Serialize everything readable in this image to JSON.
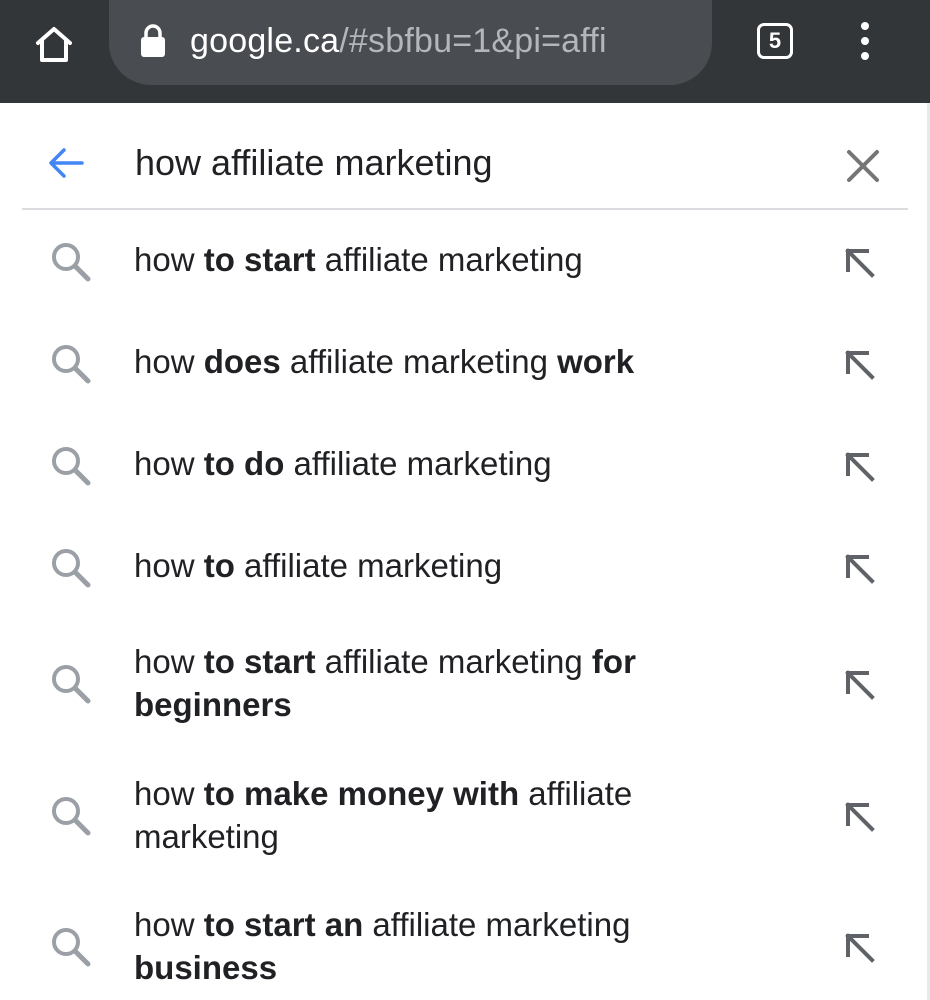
{
  "browser": {
    "url_host": "google.ca",
    "url_path": "/#sbfbu=1&pi=affi",
    "tab_count": "5",
    "icons": {
      "home": "home-icon",
      "lock": "lock-icon",
      "tabs": "tab-switcher-icon",
      "menu": "more-vert-icon"
    },
    "colors": {
      "toolbar": "#323639",
      "omnibox": "#494c50",
      "url_path": "#b4b7ba"
    }
  },
  "search": {
    "query": "how affiliate marketing",
    "icons": {
      "back": "arrow-back-icon",
      "clear": "close-icon"
    },
    "colors": {
      "back_arrow": "#4285f4",
      "icon_gray": "#757575"
    }
  },
  "suggestions": [
    {
      "parts": [
        {
          "t": "how ",
          "b": false
        },
        {
          "t": "to start",
          "b": true
        },
        {
          "t": " affiliate marketing",
          "b": false
        }
      ]
    },
    {
      "parts": [
        {
          "t": "how ",
          "b": false
        },
        {
          "t": "does",
          "b": true
        },
        {
          "t": " affiliate marketing ",
          "b": false
        },
        {
          "t": "work",
          "b": true
        }
      ]
    },
    {
      "parts": [
        {
          "t": "how ",
          "b": false
        },
        {
          "t": "to do",
          "b": true
        },
        {
          "t": " affiliate marketing",
          "b": false
        }
      ]
    },
    {
      "parts": [
        {
          "t": "how ",
          "b": false
        },
        {
          "t": "to",
          "b": true
        },
        {
          "t": " affiliate marketing",
          "b": false
        }
      ]
    },
    {
      "parts": [
        {
          "t": "how ",
          "b": false
        },
        {
          "t": "to start",
          "b": true
        },
        {
          "t": " affiliate marketing ",
          "b": false
        },
        {
          "t": "for",
          "b": true
        },
        {
          "t": " ",
          "b": false
        },
        {
          "t": "beginners",
          "b": true
        }
      ]
    },
    {
      "parts": [
        {
          "t": "how ",
          "b": false
        },
        {
          "t": "to make money with",
          "b": true
        },
        {
          "t": " affiliate marketing",
          "b": false
        }
      ]
    },
    {
      "parts": [
        {
          "t": "how ",
          "b": false
        },
        {
          "t": "to start an",
          "b": true
        },
        {
          "t": " affiliate marketing ",
          "b": false
        },
        {
          "t": "business",
          "b": true
        }
      ]
    }
  ],
  "suggestion_icons": {
    "leading": "search-icon",
    "trailing": "fill-query-arrow-icon"
  }
}
